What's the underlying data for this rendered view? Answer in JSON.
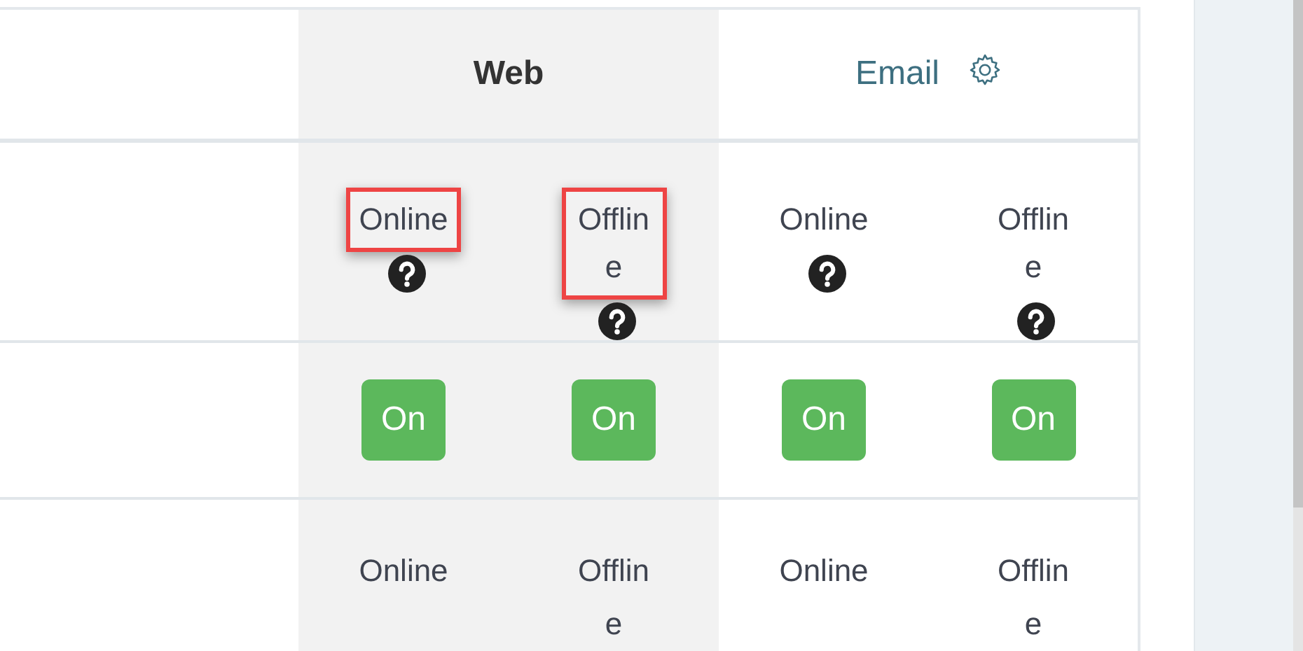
{
  "table": {
    "column_groups": [
      {
        "label": "Web",
        "shaded": true,
        "settings_button": false
      },
      {
        "label": "Email",
        "shaded": false,
        "settings_button": true
      }
    ],
    "rows": [
      {
        "kind": "status-help",
        "cells": [
          {
            "text": "Online",
            "highlighted": true
          },
          {
            "text": "Offline",
            "highlighted": true
          },
          {
            "text": "Online",
            "highlighted": false
          },
          {
            "text": "Offline",
            "highlighted": false
          }
        ]
      },
      {
        "kind": "toggle",
        "cells": [
          {
            "text": "On",
            "on": true
          },
          {
            "text": "On",
            "on": true
          },
          {
            "text": "On",
            "on": true
          },
          {
            "text": "On",
            "on": true
          }
        ]
      },
      {
        "kind": "status",
        "cells": [
          {
            "text": "Online"
          },
          {
            "text": "Offline"
          },
          {
            "text": "Online"
          },
          {
            "text": "Offline"
          }
        ]
      }
    ]
  }
}
